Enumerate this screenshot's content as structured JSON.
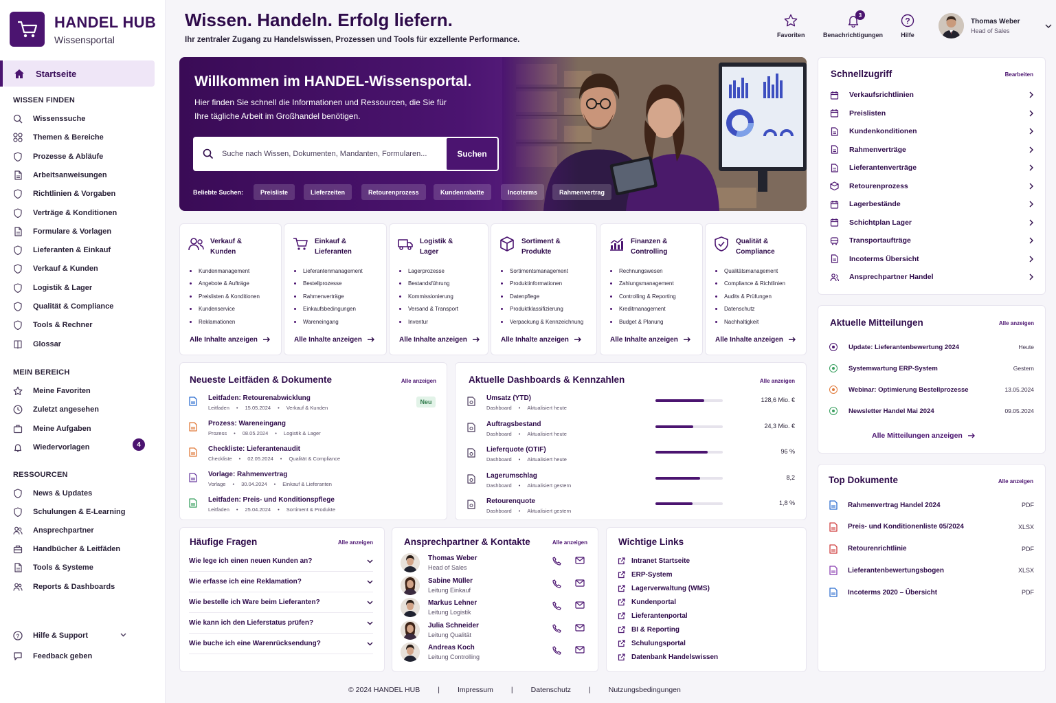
{
  "brand": {
    "title": "HANDEL HUB",
    "subtitle": "Wissensportal"
  },
  "sidebar": {
    "home": "Startseite",
    "sections": {
      "find": "WISSEN FINDEN",
      "mine": "MEIN BEREICH",
      "resources": "RESSOURCEN"
    },
    "find_items": [
      "Wissenssuche",
      "Themen & Bereiche",
      "Prozesse & Abläufe",
      "Arbeitsanweisungen",
      "Richtlinien & Vorgaben",
      "Verträge & Konditionen",
      "Formulare & Vorlagen",
      "Lieferanten & Einkauf",
      "Verkauf & Kunden",
      "Logistik & Lager",
      "Qualität & Compliance",
      "Tools & Rechner",
      "Glossar"
    ],
    "mine_items": [
      "Meine Favoriten",
      "Zuletzt angesehen",
      "Meine Aufgaben",
      "Wiedervorlagen"
    ],
    "followups_count": "4",
    "resource_items": [
      "News & Updates",
      "Schulungen & E-Learning",
      "Ansprechpartner",
      "Handbücher & Leitfäden",
      "Tools & Systeme",
      "Reports & Dashboards"
    ],
    "help": "Hilfe & Support",
    "feedback": "Feedback geben"
  },
  "header": {
    "title": "Wissen. Handeln. Erfolg liefern.",
    "subtitle": "Ihr zentraler Zugang zu Handelswissen, Prozessen und Tools für exzellente Performance.",
    "favorites": "Favoriten",
    "notifications": "Benachrichtigungen",
    "notifications_count": "3",
    "help": "Hilfe",
    "user_name": "Thomas Weber",
    "user_role": "Head of Sales"
  },
  "hero": {
    "title": "Willkommen im HANDEL-Wissensportal.",
    "text": "Hier finden Sie schnell die Informationen und Ressourcen, die Sie für Ihre tägliche Arbeit im Großhandel benötigen.",
    "search_placeholder": "Suche nach Wissen, Dokumenten, Mandanten, Formularen...",
    "search_button": "Suchen",
    "popular_label": "Beliebte Suchen:",
    "chips": [
      "Preisliste",
      "Lieferzeiten",
      "Retourenprozess",
      "Kundenrabatte",
      "Incoterms",
      "Rahmenvertrag"
    ]
  },
  "categories": [
    {
      "title1": "Verkauf &",
      "title2": "Kunden",
      "icon": "users-icon",
      "items": [
        "Kundenmanagement",
        "Angebote & Aufträge",
        "Preislisten & Konditionen",
        "Kundenservice",
        "Reklamationen"
      ]
    },
    {
      "title1": "Einkauf &",
      "title2": "Lieferanten",
      "icon": "cart-icon",
      "items": [
        "Lieferantenmanagement",
        "Bestellprozesse",
        "Rahmenverträge",
        "Einkaufsbedingungen",
        "Wareneingang"
      ]
    },
    {
      "title1": "Logistik &",
      "title2": "Lager",
      "icon": "truck-icon",
      "items": [
        "Lagerprozesse",
        "Bestandsführung",
        "Kommissionierung",
        "Versand & Transport",
        "Inventur"
      ]
    },
    {
      "title1": "Sortiment &",
      "title2": "Produkte",
      "icon": "box-icon",
      "items": [
        "Sortimentsmanagement",
        "Produktinformationen",
        "Datenpflege",
        "Produktklassifizierung",
        "Verpackung & Kennzeichnung"
      ]
    },
    {
      "title1": "Finanzen &",
      "title2": "Controlling",
      "icon": "chart-icon",
      "items": [
        "Rechnungswesen",
        "Zahlungsmanagement",
        "Controlling & Reporting",
        "Kreditmanagement",
        "Budget & Planung"
      ]
    },
    {
      "title1": "Qualität &",
      "title2": "Compliance",
      "icon": "shield-icon",
      "items": [
        "Qualitätsmanagement",
        "Compliance & Richtlinien",
        "Audits & Prüfungen",
        "Datenschutz",
        "Nachhaltigkeit"
      ]
    }
  ],
  "category_link": "Alle Inhalte anzeigen",
  "docs": {
    "title": "Neueste Leitfäden & Dokumente",
    "all": "Alle anzeigen",
    "new_badge": "Neu",
    "items": [
      {
        "title": "Leitfaden: Retourenabwicklung",
        "type": "Leitfaden",
        "date": "15.05.2024",
        "area": "Verkauf & Kunden",
        "color": "#2f6fd0"
      },
      {
        "title": "Prozess: Wareneingang",
        "type": "Prozess",
        "date": "08.05.2024",
        "area": "Logistik & Lager",
        "color": "#e07a3a"
      },
      {
        "title": "Checkliste: Lieferantenaudit",
        "type": "Checkliste",
        "date": "02.05.2024",
        "area": "Qualität & Compliance",
        "color": "#e07a3a"
      },
      {
        "title": "Vorlage: Rahmenvertrag",
        "type": "Vorlage",
        "date": "30.04.2024",
        "area": "Einkauf & Lieferanten",
        "color": "#6a3fa0"
      },
      {
        "title": "Leitfaden: Preis- und Konditionspflege",
        "type": "Leitfaden",
        "date": "25.04.2024",
        "area": "Sortiment & Produkte",
        "color": "#3aa060"
      }
    ]
  },
  "kpis": {
    "title": "Aktuelle Dashboards & Kennzahlen",
    "all": "Alle anzeigen",
    "items": [
      {
        "title": "Umsatz (YTD)",
        "type": "Dashboard",
        "status": "Aktualisiert heute",
        "value": "128,6 Mio. €",
        "fill": 0.72
      },
      {
        "title": "Auftragsbestand",
        "type": "Dashboard",
        "status": "Aktualisiert heute",
        "value": "24,3 Mio. €",
        "fill": 0.56
      },
      {
        "title": "Lieferquote (OTIF)",
        "type": "Dashboard",
        "status": "Aktualisiert heute",
        "value": "96 %",
        "fill": 0.78
      },
      {
        "title": "Lagerumschlag",
        "type": "Dashboard",
        "status": "Aktualisiert gestern",
        "value": "8,2",
        "fill": 0.66
      },
      {
        "title": "Retourenquote",
        "type": "Dashboard",
        "status": "Aktualisiert gestern",
        "value": "1,8 %",
        "fill": 0.55
      }
    ]
  },
  "faq": {
    "title": "Häufige Fragen",
    "all": "Alle anzeigen",
    "items": [
      "Wie lege ich einen neuen Kunden an?",
      "Wie erfasse ich eine Reklamation?",
      "Wie bestelle ich Ware beim Lieferanten?",
      "Wie kann ich den Lieferstatus prüfen?",
      "Wie buche ich eine Warenrücksendung?"
    ]
  },
  "contacts": {
    "title": "Ansprechpartner & Kontakte",
    "all": "Alle anzeigen",
    "items": [
      {
        "name": "Thomas Weber",
        "role": "Head of Sales",
        "gender": "m"
      },
      {
        "name": "Sabine Müller",
        "role": "Leitung Einkauf",
        "gender": "f"
      },
      {
        "name": "Markus Lehner",
        "role": "Leitung Logistik",
        "gender": "m"
      },
      {
        "name": "Julia Schneider",
        "role": "Leitung Qualität",
        "gender": "f"
      },
      {
        "name": "Andreas Koch",
        "role": "Leitung Controlling",
        "gender": "m"
      }
    ]
  },
  "links": {
    "title": "Wichtige Links",
    "items": [
      "Intranet Startseite",
      "ERP-System",
      "Lagerverwaltung (WMS)",
      "Kundenportal",
      "Lieferantenportal",
      "BI & Reporting",
      "Schulungsportal",
      "Datenbank Handelswissen"
    ]
  },
  "quick": {
    "title": "Schnellzugriff",
    "edit": "Bearbeiten",
    "items": [
      "Verkaufsrichtlinien",
      "Preislisten",
      "Kundenkonditionen",
      "Rahmenverträge",
      "Lieferantenverträge",
      "Retourenprozess",
      "Lagerbestände",
      "Schichtplan Lager",
      "Transportaufträge",
      "Incoterms Übersicht",
      "Ansprechpartner Handel"
    ]
  },
  "messages": {
    "title": "Aktuelle Mitteilungen",
    "all": "Alle anzeigen",
    "items": [
      {
        "title": "Update: Lieferantenbewertung 2024",
        "date": "Heute",
        "color": "#4b1470"
      },
      {
        "title": "Systemwartung ERP-System",
        "date": "Gestern",
        "color": "#3aa060"
      },
      {
        "title": "Webinar: Optimierung Bestellprozesse",
        "date": "13.05.2024",
        "color": "#e07a3a"
      },
      {
        "title": "Newsletter Handel Mai 2024",
        "date": "09.05.2024",
        "color": "#3aa060"
      }
    ],
    "show_all": "Alle Mitteilungen anzeigen"
  },
  "top_docs": {
    "title": "Top Dokumente",
    "all": "Alle anzeigen",
    "items": [
      {
        "title": "Rahmenvertrag Handel 2024",
        "ext": "PDF",
        "color": "#2f6fd0"
      },
      {
        "title": "Preis- und Konditionenliste 05/2024",
        "ext": "XLSX",
        "color": "#d04040"
      },
      {
        "title": "Retourenrichtlinie",
        "ext": "PDF",
        "color": "#d04040"
      },
      {
        "title": "Lieferantenbewertungsbogen",
        "ext": "XLSX",
        "color": "#8a3fb0"
      },
      {
        "title": "Incoterms 2020 – Übersicht",
        "ext": "PDF",
        "color": "#2f6fd0"
      }
    ]
  },
  "footer": {
    "copyright": "© 2024 HANDEL HUB",
    "sep": "|",
    "imprint": "Impressum",
    "privacy": "Datenschutz",
    "terms": "Nutzungsbedingungen"
  }
}
